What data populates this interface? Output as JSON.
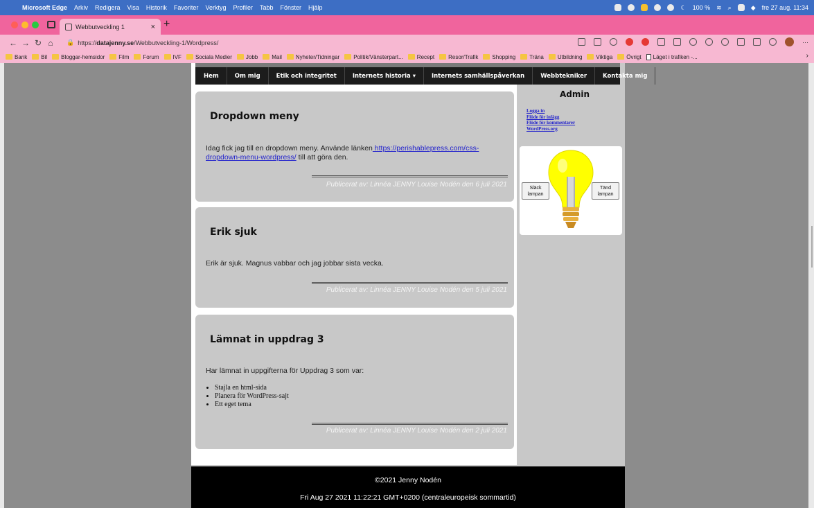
{
  "menubar": {
    "app_name": "Microsoft Edge",
    "items": [
      "Arkiv",
      "Redigera",
      "Visa",
      "Historik",
      "Favoriter",
      "Verktyg",
      "Profiler",
      "Tabb",
      "Fönster",
      "Hjälp"
    ],
    "battery": "100 %",
    "datetime": "fre 27 aug. 11:34"
  },
  "tab": {
    "title": "Webbutveckling 1"
  },
  "addressbar": {
    "url_prefix": "https://",
    "url_host": "datajenny.se",
    "url_path": "/Webbutveckling-1/Wordpress/"
  },
  "bookmarks": [
    {
      "label": "Bank",
      "type": "folder"
    },
    {
      "label": "Bil",
      "type": "folder"
    },
    {
      "label": "Bloggar-hemsidor",
      "type": "folder"
    },
    {
      "label": "Film",
      "type": "folder"
    },
    {
      "label": "Forum",
      "type": "folder"
    },
    {
      "label": "IVF",
      "type": "folder"
    },
    {
      "label": "Sociala Medier",
      "type": "folder"
    },
    {
      "label": "Jobb",
      "type": "folder"
    },
    {
      "label": "Mail",
      "type": "folder"
    },
    {
      "label": "Nyheter/Tidningar",
      "type": "folder"
    },
    {
      "label": "Politik/Vänsterpart...",
      "type": "folder"
    },
    {
      "label": "Recept",
      "type": "folder"
    },
    {
      "label": "Resor/Trafik",
      "type": "folder"
    },
    {
      "label": "Shopping",
      "type": "folder"
    },
    {
      "label": "Träna",
      "type": "folder"
    },
    {
      "label": "Utbildning",
      "type": "folder"
    },
    {
      "label": "Viktiga",
      "type": "folder"
    },
    {
      "label": "Övrigt",
      "type": "folder"
    },
    {
      "label": "Läget i trafiken -...",
      "type": "page"
    }
  ],
  "site": {
    "nav": [
      "Hem",
      "Om mig",
      "Etik och integritet",
      "Internets historia ▾",
      "Internets samhällspåverkan",
      "Webbtekniker",
      "Kontakta mig"
    ],
    "posts": [
      {
        "title": "Dropdown meny",
        "text_before": "Idag fick jag till en dropdown meny. Använde länken",
        "link": " https://perishablepress.com/css-dropdown-menu-wordpress/",
        "text_after": " till att göra den.",
        "meta": "Publicerat av: Linnéa JENNY Louise Nodén den 6 juli 2021"
      },
      {
        "title": "Erik sjuk",
        "text": "Erik är sjuk. Magnus vabbar och jag jobbar sista vecka.",
        "meta": "Publicerat av: Linnéa JENNY Louise Nodén den 5 juli 2021"
      },
      {
        "title": "Lämnat in uppdrag 3",
        "text": "Har lämnat in uppgifterna för Uppdrag 3 som var:",
        "list": [
          "Stajla en html-sida",
          "Planera för WordPress-sajt",
          "Ett eget tema"
        ],
        "meta": "Publicerat av: Linnéa JENNY Louise Nodén den 2 juli 2021"
      }
    ],
    "admin": {
      "title": "Admin",
      "links": [
        "Logga in",
        "Flöde för inlägg",
        "Flöde för kommentarer",
        "WordPress.org"
      ]
    },
    "lamp": {
      "off_label": "Släck lampan",
      "on_label": "Tänd lampan"
    },
    "footer": {
      "copyright": "©2021 Jenny Nodén",
      "date": "Fri Aug 27 2021 11:22:21 GMT+0200 (centraleuropeisk sommartid)"
    }
  },
  "colors": {
    "menubar": "#3d6ec4",
    "tabstrip": "#f0649d",
    "toolbar": "#f7b8d2",
    "page_bg": "#8c8c8c",
    "card_bg": "#c8c8c8",
    "nav_bg": "#1c1c1c",
    "bulb": "#ffff00"
  }
}
